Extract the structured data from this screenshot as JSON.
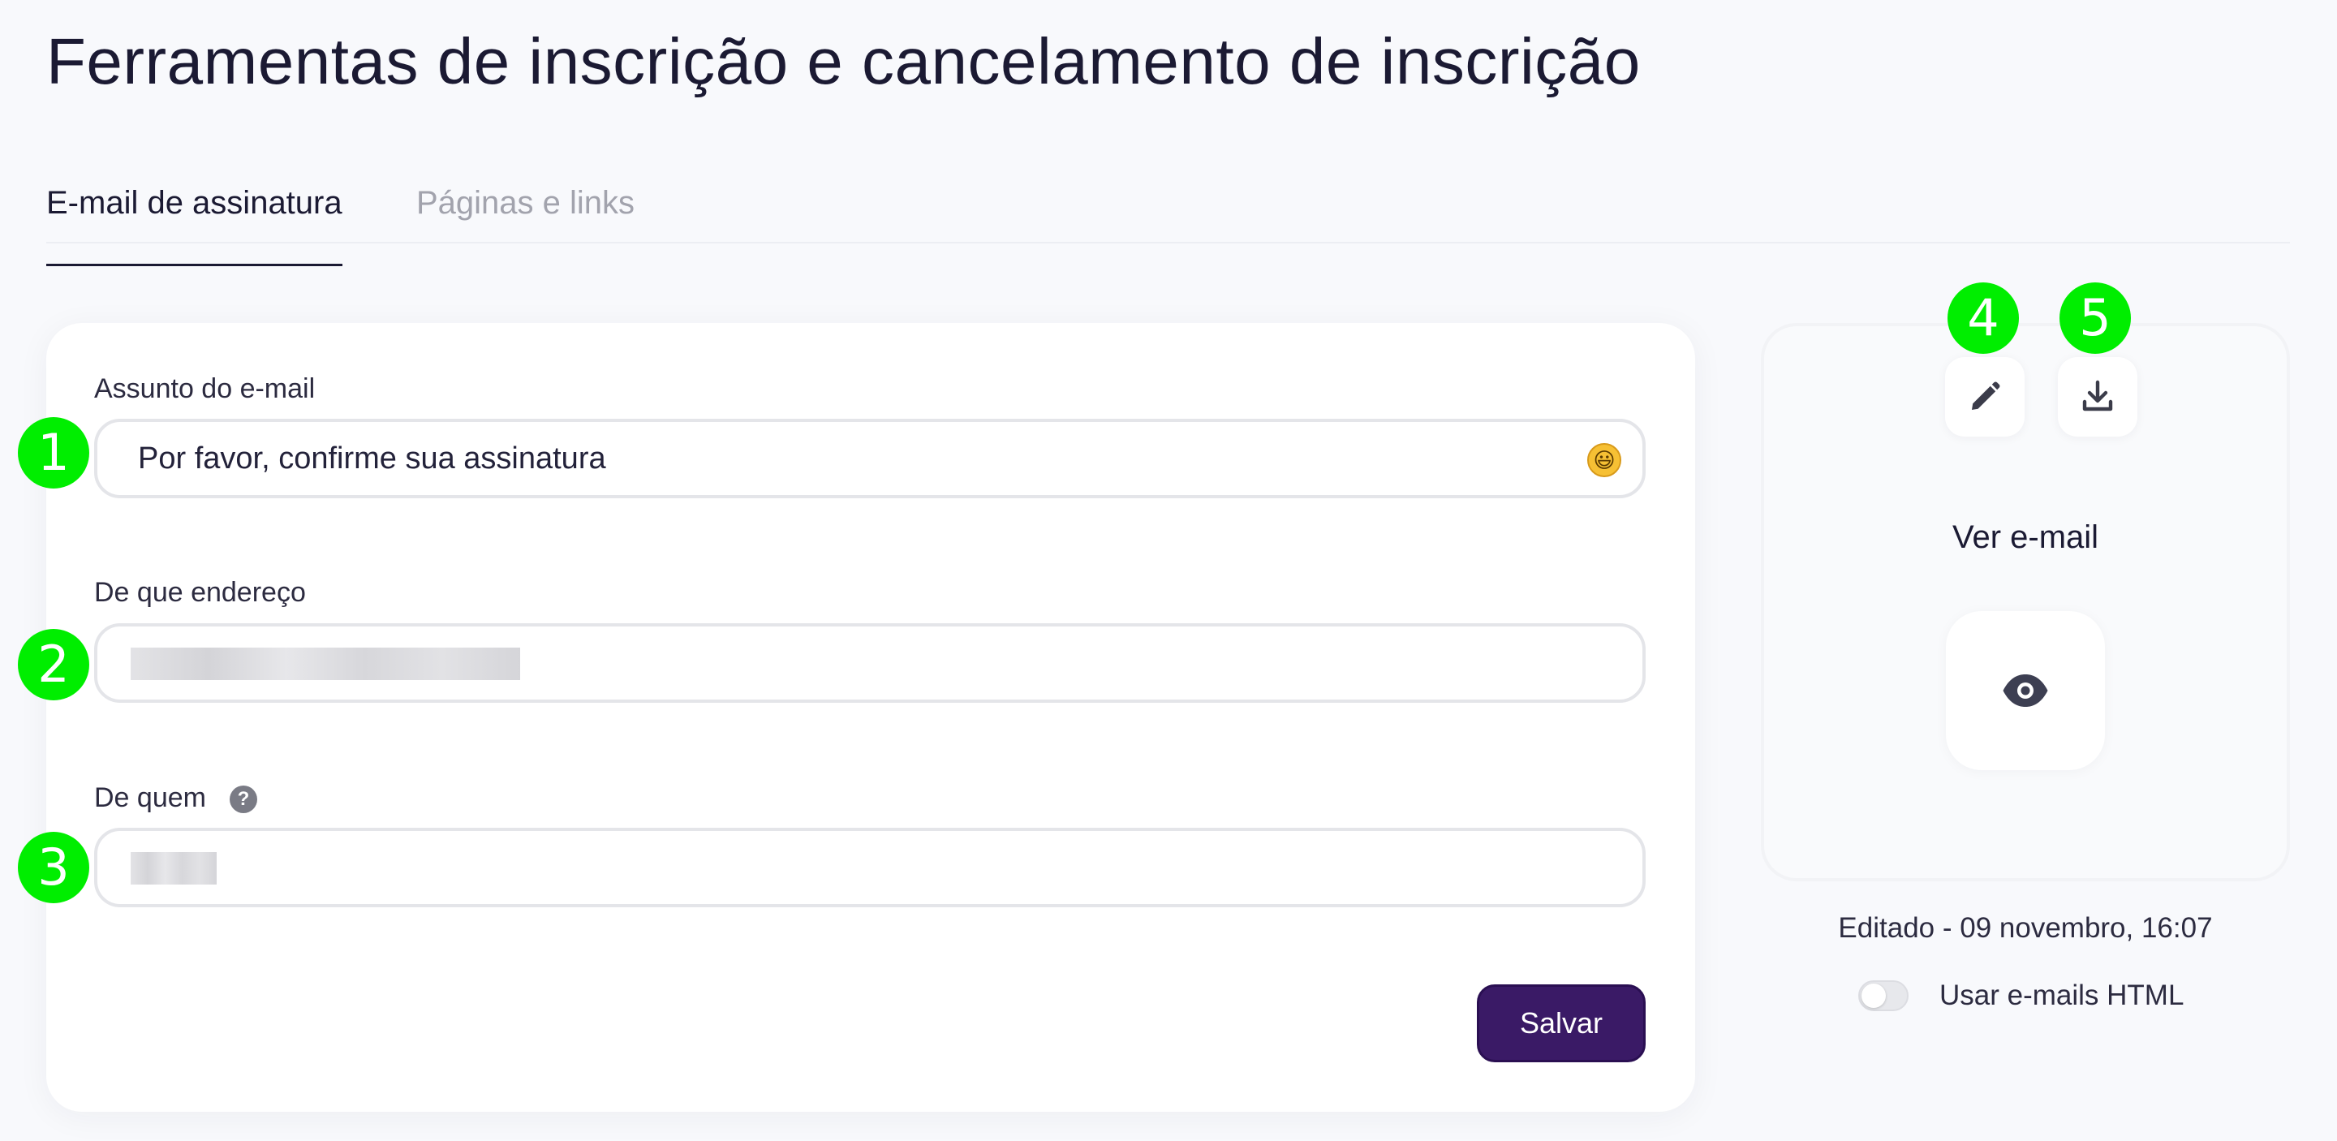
{
  "page": {
    "title": "Ferramentas de inscrição e cancelamento de inscrição"
  },
  "tabs": [
    {
      "label": "E-mail de assinatura",
      "active": true
    },
    {
      "label": "Páginas e links",
      "active": false
    }
  ],
  "form": {
    "subject": {
      "label": "Assunto do e-mail",
      "value": "Por favor, confirme sua assinatura",
      "emoji": "😃"
    },
    "from_address": {
      "label": "De que endereço",
      "value_redacted": true
    },
    "from_name": {
      "label": "De quem",
      "help_icon": "?",
      "value_redacted": true
    },
    "save_label": "Salvar"
  },
  "preview": {
    "edit_icon": "pencil-icon",
    "download_icon": "download-icon",
    "label": "Ver e-mail",
    "view_icon": "eye-icon",
    "edited": "Editado - 09 novembro, 16:07",
    "html_toggle": {
      "label": "Usar e-mails HTML",
      "on": false
    }
  },
  "markers": [
    "1",
    "2",
    "3",
    "4",
    "5"
  ],
  "colors": {
    "accent": "#3a1a66",
    "marker": "#00ee00",
    "background": "#f8f9fc"
  }
}
